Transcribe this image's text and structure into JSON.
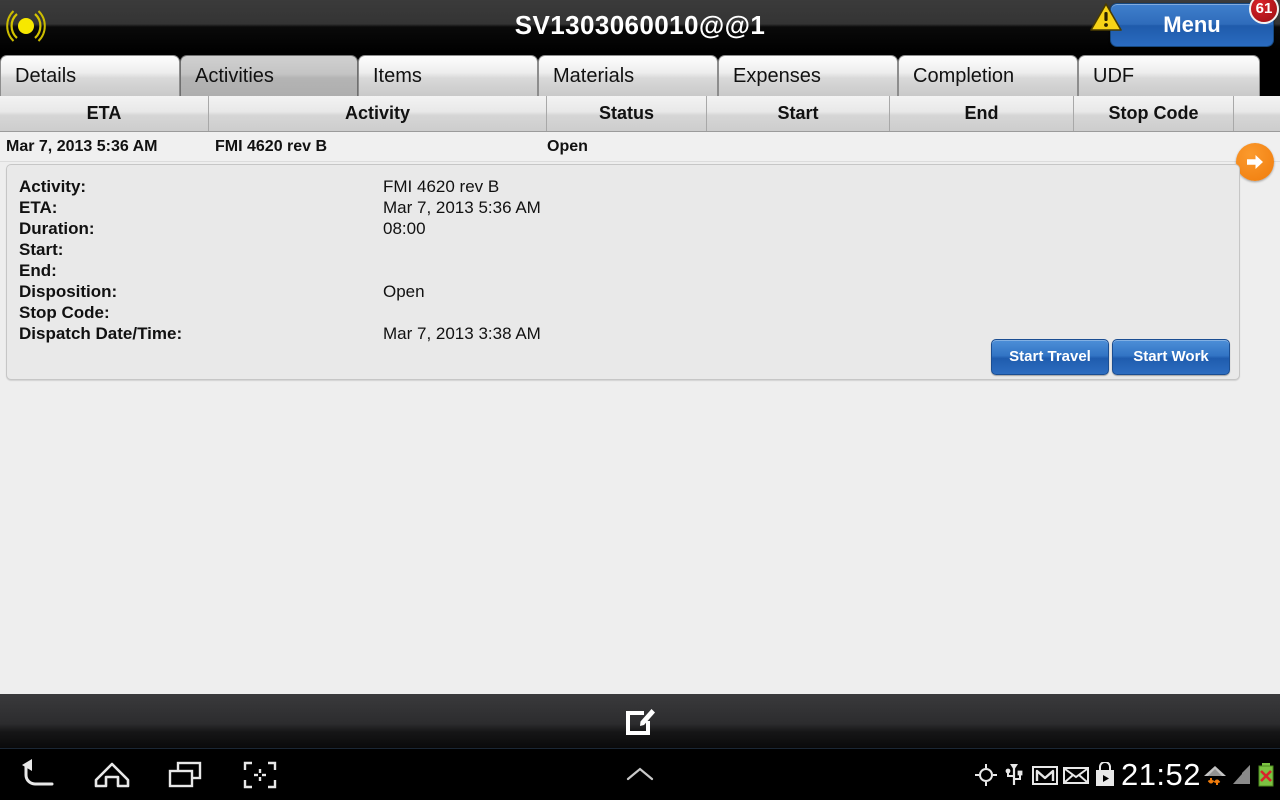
{
  "titlebar": {
    "logo_icon": "signal-broadcast-icon",
    "title": "SV1303060010@@1",
    "menu_label": "Menu",
    "warning_icon": "warning-triangle-icon",
    "badge_count": "61"
  },
  "tabs": [
    {
      "label": "Details",
      "selected": false
    },
    {
      "label": "Activities",
      "selected": true
    },
    {
      "label": "Items",
      "selected": false
    },
    {
      "label": "Materials",
      "selected": false
    },
    {
      "label": "Expenses",
      "selected": false
    },
    {
      "label": "Completion",
      "selected": false
    },
    {
      "label": "UDF",
      "selected": false
    }
  ],
  "table": {
    "columns": [
      "ETA",
      "Activity",
      "Status",
      "Start",
      "End",
      "Stop Code"
    ],
    "rows": [
      {
        "eta": "Mar 7, 2013 5:36 AM",
        "activity": "FMI 4620 rev B",
        "status": "Open",
        "start": "",
        "end": "",
        "stop_code": ""
      }
    ],
    "expand_icon": "arrow-right-circle-icon"
  },
  "detail": {
    "fields": [
      {
        "label": "Activity:",
        "value": "FMI 4620 rev B"
      },
      {
        "label": "ETA:",
        "value": "Mar 7, 2013 5:36 AM"
      },
      {
        "label": "Duration:",
        "value": "08:00"
      },
      {
        "label": "Start:",
        "value": ""
      },
      {
        "label": "End:",
        "value": ""
      },
      {
        "label": "Disposition:",
        "value": "Open"
      },
      {
        "label": "Stop Code:",
        "value": ""
      },
      {
        "label": "Dispatch Date/Time:",
        "value": "Mar 7, 2013 3:38 AM"
      }
    ],
    "buttons": [
      {
        "label": "Start Travel"
      },
      {
        "label": "Start Work"
      }
    ]
  },
  "softbar": {
    "edit_icon": "edit-compose-icon"
  },
  "navbar": {
    "buttons": [
      {
        "icon": "back-icon"
      },
      {
        "icon": "home-icon"
      },
      {
        "icon": "recent-apps-icon"
      },
      {
        "icon": "screenshot-icon"
      },
      {
        "icon": "chevron-up-icon"
      }
    ],
    "status_icons": [
      {
        "icon": "gps-crosshair-icon"
      },
      {
        "icon": "usb-icon"
      },
      {
        "icon": "gmail-icon"
      },
      {
        "icon": "email-envelope-icon"
      },
      {
        "icon": "play-store-icon"
      },
      {
        "icon": "wifi-icon"
      },
      {
        "icon": "cell-signal-icon"
      },
      {
        "icon": "battery-error-icon"
      }
    ],
    "clock": "21:52"
  },
  "colors": {
    "accent_blue": "#2f6cbb",
    "accent_orange": "#f07c0c",
    "badge_red": "#b8151b",
    "warning_yellow": "#f5d000",
    "panel_bg": "#e9e9e9"
  }
}
